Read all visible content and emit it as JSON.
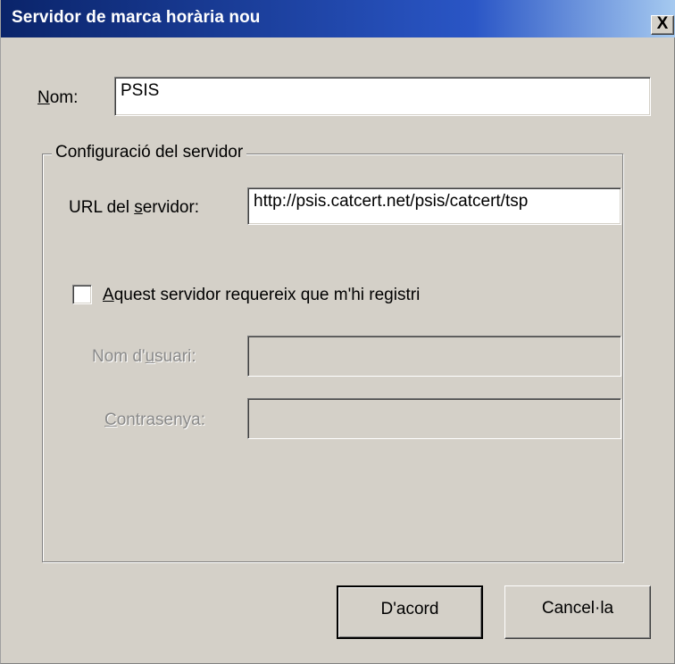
{
  "window": {
    "title": "Servidor de marca horària nou",
    "close_icon": "close-icon",
    "close_glyph": "X"
  },
  "name": {
    "label": "Nom:",
    "value": "PSIS"
  },
  "server_group": {
    "legend": "Configuració del servidor",
    "url_label": "URL del servidor:",
    "url_value": "http://psis.catcert.net/psis/catcert/tsp",
    "requires_registration": {
      "label": "Aquest servidor requereix que m'hi registri",
      "checked": false
    },
    "username": {
      "label": "Nom d'usuari:",
      "value": "",
      "disabled": true
    },
    "password": {
      "label": "Contrasenya:",
      "value": "",
      "disabled": true
    }
  },
  "buttons": {
    "ok": "D'acord",
    "cancel": "Cancel·la"
  },
  "colors": {
    "titlebar": "#0a246a",
    "dialog_bg": "#d4d0c8"
  }
}
